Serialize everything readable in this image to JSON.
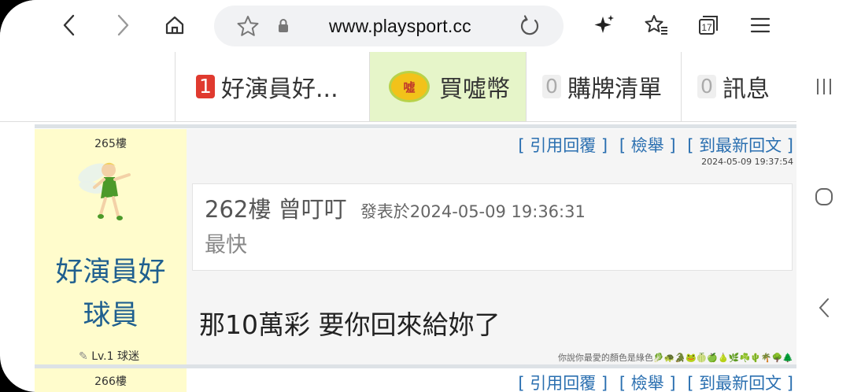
{
  "browser": {
    "url": "www.playsport.cc",
    "tab_count": "17"
  },
  "site_tabs": {
    "user": {
      "badge": "1",
      "label": "好演員好..."
    },
    "buy": {
      "coin_text": "噓",
      "label": "買噓幣"
    },
    "cart": {
      "badge": "0",
      "label": "購牌清單"
    },
    "messages": {
      "badge": "0",
      "label": "訊息"
    }
  },
  "post": {
    "floor": "265樓",
    "username_line1": "好演員好",
    "username_line2": "球員",
    "level": "Lv.1 球迷",
    "actions": [
      "[ 引用回覆 ]",
      "[ 檢舉 ]",
      "[ 到最新回文 ]"
    ],
    "timestamp": "2024-05-09 19:37:54",
    "quote": {
      "floor": "262樓",
      "author": "曾叮叮",
      "meta": "發表於2024-05-09 19:36:31",
      "body": "最快"
    },
    "reply": "那10萬彩 要你回來給妳了",
    "signature": "你說你最愛的顏色是綠色🥬🐢🐊🐸🍈🍏🍐🌿☘️🌵🌴🌳🌲"
  },
  "next_post": {
    "floor": "266樓",
    "actions": [
      "[ 引用回覆 ]",
      "[ 檢舉 ]",
      "[ 到最新回文 ]"
    ]
  },
  "colors": {
    "username": "#1f5f8f",
    "link": "#2a6fb0",
    "user_panel_bg": "#fffccc",
    "buy_tab_bg": "#e6f5c9",
    "badge_red": "#e03a2f"
  }
}
